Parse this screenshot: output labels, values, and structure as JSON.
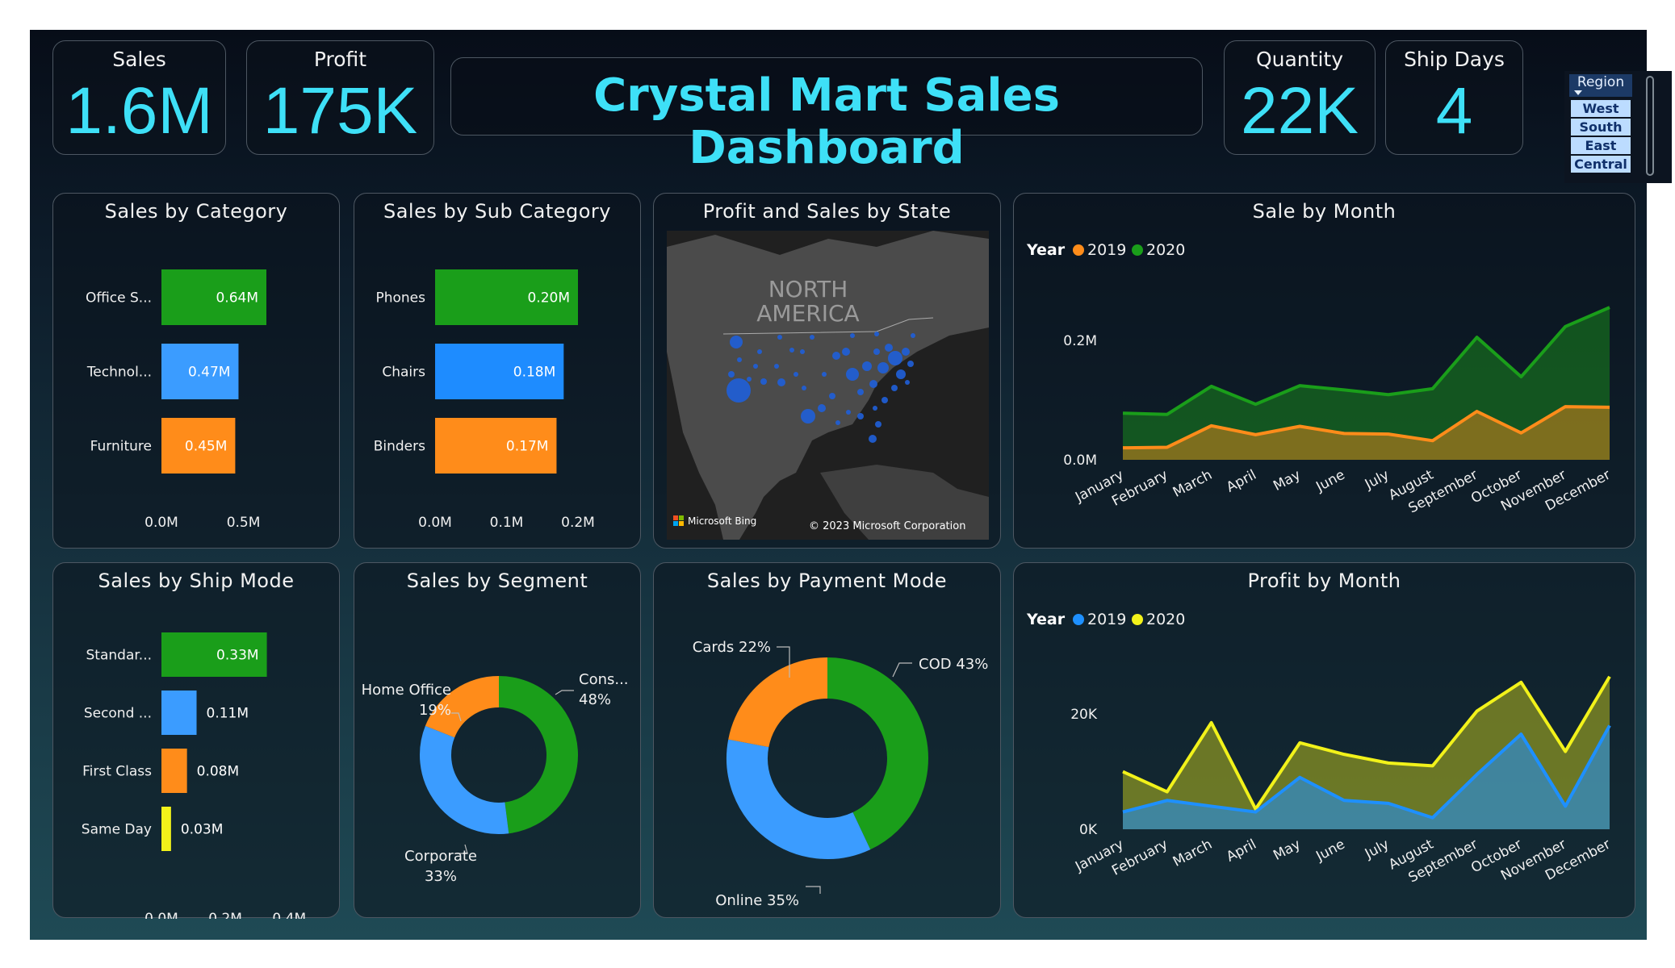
{
  "kpis": {
    "sales": {
      "label": "Sales",
      "value": "1.6M"
    },
    "profit": {
      "label": "Profit",
      "value": "175K"
    },
    "quantity": {
      "label": "Quantity",
      "value": "22K"
    },
    "ship_days": {
      "label": "Ship Days",
      "value": "4"
    }
  },
  "dashboard_title": "Crystal Mart Sales Dashboard",
  "region_slicer": {
    "label": "Region",
    "items": [
      "West",
      "South",
      "East",
      "Central"
    ]
  },
  "colors": {
    "green": "#1a9e1a",
    "blue": "#3b9cff",
    "orange": "#ff8c1a",
    "yellow": "#f2f21a",
    "cyan": "#3ee0f7",
    "bright_blue": "#1e90ff"
  },
  "panels": {
    "category": {
      "title": "Sales by Category"
    },
    "subcategory": {
      "title": "Sales by Sub Category"
    },
    "map": {
      "title": "Profit and Sales by State",
      "region_label_1": "NORTH",
      "region_label_2": "AMERICA",
      "bing": "Microsoft Bing",
      "copyright": "© 2023 Microsoft Corporation"
    },
    "sale_month": {
      "title": "Sale by Month",
      "legend_title": "Year"
    },
    "ship_mode": {
      "title": "Sales by Ship Mode"
    },
    "segment": {
      "title": "Sales by Segment"
    },
    "payment": {
      "title": "Sales by Payment Mode"
    },
    "profit_month": {
      "title": "Profit by Month",
      "legend_title": "Year"
    }
  },
  "chart_data": [
    {
      "id": "category",
      "type": "bar",
      "orientation": "horizontal",
      "categories": [
        "Office S...",
        "Technol...",
        "Furniture"
      ],
      "values": [
        0.64,
        0.47,
        0.45
      ],
      "labels": [
        "0.64M",
        "0.47M",
        "0.45M"
      ],
      "colors": [
        "#1a9e1a",
        "#3b9cff",
        "#ff8c1a"
      ],
      "xlim": [
        0,
        0.64
      ],
      "xticks": [
        "0.0M",
        "0.5M"
      ],
      "xtick_values": [
        0,
        0.5
      ]
    },
    {
      "id": "subcategory",
      "type": "bar",
      "orientation": "horizontal",
      "categories": [
        "Phones",
        "Chairs",
        "Binders"
      ],
      "values": [
        0.2,
        0.18,
        0.17
      ],
      "labels": [
        "0.20M",
        "0.18M",
        "0.17M"
      ],
      "colors": [
        "#1a9e1a",
        "#1e8cff",
        "#ff8c1a"
      ],
      "xlim": [
        0,
        0.2
      ],
      "xticks": [
        "0.0M",
        "0.1M",
        "0.2M"
      ],
      "xtick_values": [
        0,
        0.1,
        0.2
      ]
    },
    {
      "id": "ship_mode",
      "type": "bar",
      "orientation": "horizontal",
      "categories": [
        "Standar...",
        "Second ...",
        "First Class",
        "Same Day"
      ],
      "values": [
        0.33,
        0.11,
        0.08,
        0.03
      ],
      "labels": [
        "0.33M",
        "0.11M",
        "0.08M",
        "0.03M"
      ],
      "colors": [
        "#1a9e1a",
        "#3b9cff",
        "#ff8c1a",
        "#f2f21a"
      ],
      "xlim": [
        0,
        0.46
      ],
      "xticks": [
        "0.0M",
        "0.2M",
        "0.4M"
      ],
      "xtick_values": [
        0,
        0.2,
        0.4
      ]
    },
    {
      "id": "segment",
      "type": "pie",
      "donut": true,
      "slices": [
        {
          "label": "Cons...",
          "value": 48,
          "pct": "48%",
          "color": "#1a9e1a"
        },
        {
          "label": "Corporate",
          "value": 33,
          "pct": "33%",
          "color": "#3b9cff"
        },
        {
          "label": "Home Office",
          "value": 19,
          "pct": "19%",
          "color": "#ff8c1a"
        }
      ]
    },
    {
      "id": "payment",
      "type": "pie",
      "donut": true,
      "slices": [
        {
          "label": "COD",
          "value": 43,
          "pct": "43%",
          "color": "#1a9e1a"
        },
        {
          "label": "Online",
          "value": 35,
          "pct": "35%",
          "color": "#3b9cff"
        },
        {
          "label": "Cards",
          "value": 22,
          "pct": "22%",
          "color": "#ff8c1a"
        }
      ]
    },
    {
      "id": "sale_month",
      "type": "area",
      "x": [
        "January",
        "February",
        "March",
        "April",
        "May",
        "June",
        "July",
        "August",
        "September",
        "October",
        "November",
        "December"
      ],
      "series": [
        {
          "name": "2019",
          "color": "#ff8c1a",
          "values": [
            0.02,
            0.021,
            0.057,
            0.042,
            0.056,
            0.044,
            0.043,
            0.032,
            0.081,
            0.045,
            0.089,
            0.088
          ]
        },
        {
          "name": "2020",
          "color": "#1a9e1a",
          "values": [
            0.078,
            0.076,
            0.123,
            0.093,
            0.124,
            0.117,
            0.109,
            0.119,
            0.205,
            0.139,
            0.223,
            0.255
          ]
        }
      ],
      "ylim": [
        0,
        0.27
      ],
      "yticks": [
        "0.0M",
        "0.2M"
      ],
      "ytick_values": [
        0,
        0.2
      ]
    },
    {
      "id": "profit_month",
      "type": "area",
      "x": [
        "January",
        "February",
        "March",
        "April",
        "May",
        "June",
        "July",
        "August",
        "September",
        "October",
        "November",
        "December"
      ],
      "series": [
        {
          "name": "2019",
          "color": "#1e90ff",
          "values": [
            3000,
            5000,
            4000,
            3000,
            9000,
            5000,
            4500,
            2000,
            9500,
            16500,
            4000,
            18000
          ]
        },
        {
          "name": "2020",
          "color": "#f2f21a",
          "values": [
            10000,
            6500,
            18500,
            3500,
            15000,
            13000,
            11500,
            11000,
            20500,
            25500,
            13500,
            26500
          ]
        }
      ],
      "ylim": [
        0,
        28000
      ],
      "yticks": [
        "0K",
        "20K"
      ],
      "ytick_values": [
        0,
        20000
      ]
    }
  ]
}
